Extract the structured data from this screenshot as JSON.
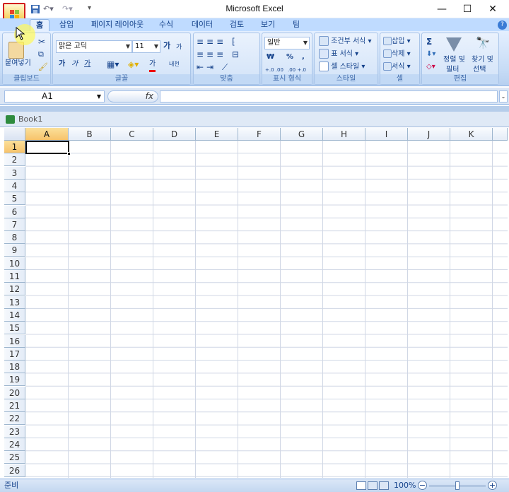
{
  "app": {
    "title": "Microsoft Excel"
  },
  "qat": {
    "customize": "▾"
  },
  "window": {
    "minimize": "—",
    "maximize": "☐",
    "close": "✕"
  },
  "tabs": [
    {
      "label": "홈",
      "active": true
    },
    {
      "label": "삽입"
    },
    {
      "label": "페이지 레이아웃"
    },
    {
      "label": "수식"
    },
    {
      "label": "데이터"
    },
    {
      "label": "검토"
    },
    {
      "label": "보기"
    },
    {
      "label": "팀"
    }
  ],
  "help": "?",
  "ribbon": {
    "clipboard": {
      "paste": "붙여넣기",
      "label": "클립보드"
    },
    "font": {
      "name": "맑은 고딕",
      "size": "11",
      "grow": "가",
      "shrink": "가",
      "bold": "가",
      "italic": "가",
      "underline": "가",
      "color_a": "가",
      "phonetic": "내천",
      "label": "글꼴"
    },
    "alignment": {
      "label": "맞춤"
    },
    "number": {
      "format": "일반",
      "currency": "₩",
      "percent": "%",
      "comma": ",",
      "inc": "+.0 .00",
      "dec": ".00 +.0",
      "label": "표시 형식"
    },
    "styles": {
      "conditional": "조건부 서식",
      "table": "표 서식",
      "cell": "셀 스타일",
      "label": "스타일"
    },
    "cells": {
      "insert": "삽입",
      "delete": "삭제",
      "format": "서식",
      "label": "셀"
    },
    "editing": {
      "sigma": "Σ",
      "sort": "정렬 및",
      "sort2": "필터",
      "find": "찾기 및",
      "find2": "선택",
      "label": "편집"
    }
  },
  "formula_bar": {
    "name_box": "A1",
    "fx": "fx"
  },
  "workbook": {
    "title": "Book1"
  },
  "grid": {
    "columns": [
      "A",
      "B",
      "C",
      "D",
      "E",
      "F",
      "G",
      "H",
      "I",
      "J",
      "K"
    ],
    "rows": [
      "1",
      "2",
      "3",
      "4",
      "5",
      "6",
      "7",
      "8",
      "9",
      "10",
      "11",
      "12",
      "13",
      "14",
      "15",
      "16",
      "17",
      "18",
      "19",
      "20",
      "21",
      "22",
      "23",
      "24",
      "25",
      "26"
    ],
    "active_cell": "A1"
  },
  "status": {
    "ready": "준비",
    "zoom": "100%"
  },
  "colors": {
    "accent": "#15428b",
    "ribbon": "#dbe7f7",
    "selected_header": "#f7c36b"
  }
}
